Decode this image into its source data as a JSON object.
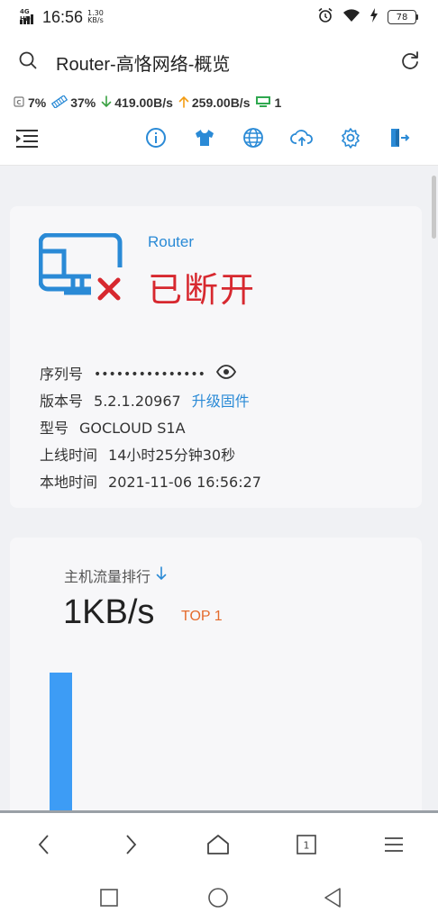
{
  "status_bar": {
    "network_tag": "4G HD",
    "time": "16:56",
    "net_speed_value": "1.30",
    "net_speed_unit": "KB/s",
    "battery_level": "78"
  },
  "browser": {
    "title": "Router-高恪网络-概览"
  },
  "stats": {
    "cpu": "7%",
    "memory": "37%",
    "download": "419.00B/s",
    "upload": "259.00B/s",
    "devices": "1"
  },
  "toolbar": {
    "icons": [
      "info-icon",
      "theme-shirt-icon",
      "globe-icon",
      "cloud-upload-icon",
      "settings-gear-icon",
      "logout-icon"
    ]
  },
  "router_card": {
    "brand": "Router",
    "connection_status": "已断开",
    "serial_label": "序列号",
    "serial_value": "•••••••••••••••",
    "version_label": "版本号",
    "version_value": "5.2.1.20967",
    "upgrade_link": "升级固件",
    "model_label": "型号",
    "model_value": "GOCLOUD S1A",
    "uptime_label": "上线时间",
    "uptime_value": "14小时25分钟30秒",
    "localtime_label": "本地时间",
    "localtime_value": "2021-11-06 16:56:27"
  },
  "traffic_card": {
    "title": "主机流量排行",
    "value": "1KB/s",
    "badge": "TOP 1",
    "colors": {
      "bar": "#3d9cf5",
      "badge": "#e46b2c"
    }
  },
  "bottom_nav": {
    "tab_count": "1"
  },
  "colors": {
    "accent": "#2a8ad6",
    "disconnected": "#d7282f",
    "download_arrow": "#3aa142",
    "upload_arrow": "#f39c12",
    "device_icon": "#2fa84f"
  }
}
